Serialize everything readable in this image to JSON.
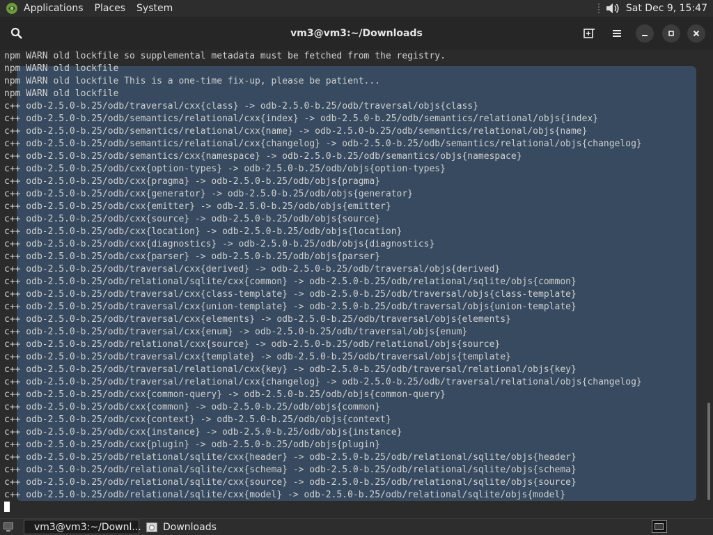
{
  "top_panel": {
    "menus": [
      "Applications",
      "Places",
      "System"
    ],
    "clock": "Sat Dec 9, 15:47"
  },
  "window": {
    "title": "vm3@vm3:~/Downloads"
  },
  "terminal": {
    "lines": [
      "npm WARN old lockfile so supplemental metadata must be fetched from the registry.",
      "npm WARN old lockfile",
      "npm WARN old lockfile This is a one-time fix-up, please be patient...",
      "npm WARN old lockfile",
      "c++ odb-2.5.0-b.25/odb/traversal/cxx{class} -> odb-2.5.0-b.25/odb/traversal/objs{class}",
      "c++ odb-2.5.0-b.25/odb/semantics/relational/cxx{index} -> odb-2.5.0-b.25/odb/semantics/relational/objs{index}",
      "c++ odb-2.5.0-b.25/odb/semantics/relational/cxx{name} -> odb-2.5.0-b.25/odb/semantics/relational/objs{name}",
      "c++ odb-2.5.0-b.25/odb/semantics/relational/cxx{changelog} -> odb-2.5.0-b.25/odb/semantics/relational/objs{changelog}",
      "c++ odb-2.5.0-b.25/odb/semantics/cxx{namespace} -> odb-2.5.0-b.25/odb/semantics/objs{namespace}",
      "c++ odb-2.5.0-b.25/odb/cxx{option-types} -> odb-2.5.0-b.25/odb/objs{option-types}",
      "c++ odb-2.5.0-b.25/odb/cxx{pragma} -> odb-2.5.0-b.25/odb/objs{pragma}",
      "c++ odb-2.5.0-b.25/odb/cxx{generator} -> odb-2.5.0-b.25/odb/objs{generator}",
      "c++ odb-2.5.0-b.25/odb/cxx{emitter} -> odb-2.5.0-b.25/odb/objs{emitter}",
      "c++ odb-2.5.0-b.25/odb/cxx{source} -> odb-2.5.0-b.25/odb/objs{source}",
      "c++ odb-2.5.0-b.25/odb/cxx{location} -> odb-2.5.0-b.25/odb/objs{location}",
      "c++ odb-2.5.0-b.25/odb/cxx{diagnostics} -> odb-2.5.0-b.25/odb/objs{diagnostics}",
      "c++ odb-2.5.0-b.25/odb/cxx{parser} -> odb-2.5.0-b.25/odb/objs{parser}",
      "c++ odb-2.5.0-b.25/odb/traversal/cxx{derived} -> odb-2.5.0-b.25/odb/traversal/objs{derived}",
      "c++ odb-2.5.0-b.25/odb/relational/sqlite/cxx{common} -> odb-2.5.0-b.25/odb/relational/sqlite/objs{common}",
      "c++ odb-2.5.0-b.25/odb/traversal/cxx{class-template} -> odb-2.5.0-b.25/odb/traversal/objs{class-template}",
      "c++ odb-2.5.0-b.25/odb/traversal/cxx{union-template} -> odb-2.5.0-b.25/odb/traversal/objs{union-template}",
      "c++ odb-2.5.0-b.25/odb/traversal/cxx{elements} -> odb-2.5.0-b.25/odb/traversal/objs{elements}",
      "c++ odb-2.5.0-b.25/odb/traversal/cxx{enum} -> odb-2.5.0-b.25/odb/traversal/objs{enum}",
      "c++ odb-2.5.0-b.25/odb/relational/cxx{source} -> odb-2.5.0-b.25/odb/relational/objs{source}",
      "c++ odb-2.5.0-b.25/odb/traversal/cxx{template} -> odb-2.5.0-b.25/odb/traversal/objs{template}",
      "c++ odb-2.5.0-b.25/odb/traversal/relational/cxx{key} -> odb-2.5.0-b.25/odb/traversal/relational/objs{key}",
      "c++ odb-2.5.0-b.25/odb/traversal/relational/cxx{changelog} -> odb-2.5.0-b.25/odb/traversal/relational/objs{changelog}",
      "c++ odb-2.5.0-b.25/odb/cxx{common-query} -> odb-2.5.0-b.25/odb/objs{common-query}",
      "c++ odb-2.5.0-b.25/odb/cxx{common} -> odb-2.5.0-b.25/odb/objs{common}",
      "c++ odb-2.5.0-b.25/odb/cxx{context} -> odb-2.5.0-b.25/odb/objs{context}",
      "c++ odb-2.5.0-b.25/odb/cxx{instance} -> odb-2.5.0-b.25/odb/objs{instance}",
      "c++ odb-2.5.0-b.25/odb/cxx{plugin} -> odb-2.5.0-b.25/odb/objs{plugin}",
      "c++ odb-2.5.0-b.25/odb/relational/sqlite/cxx{header} -> odb-2.5.0-b.25/odb/relational/sqlite/objs{header}",
      "c++ odb-2.5.0-b.25/odb/relational/sqlite/cxx{schema} -> odb-2.5.0-b.25/odb/relational/sqlite/objs{schema}",
      "c++ odb-2.5.0-b.25/odb/relational/sqlite/cxx{source} -> odb-2.5.0-b.25/odb/relational/sqlite/objs{source}",
      "c++ odb-2.5.0-b.25/odb/relational/sqlite/cxx{model} -> odb-2.5.0-b.25/odb/relational/sqlite/objs{model}"
    ]
  },
  "taskbar": {
    "tasks": [
      {
        "label": "vm3@vm3:~/Downl...",
        "active": true
      },
      {
        "label": "Downloads",
        "active": false
      }
    ]
  },
  "colors": {
    "selection": "#374a5f",
    "terminal_bg": "#2b2b2b",
    "terminal_text": "#d0d0d0"
  }
}
